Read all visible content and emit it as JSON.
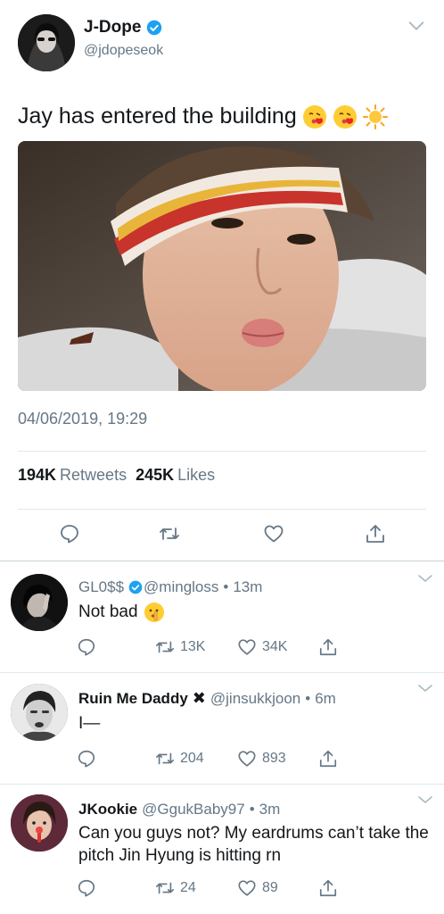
{
  "main": {
    "author_name": "J-Dope",
    "author_handle": "@jdopeseok",
    "text": "Jay has entered the building",
    "timestamp": "04/06/2019, 19:29",
    "retweets_count": "194K",
    "retweets_label": "Retweets",
    "likes_count": "245K",
    "likes_label": "Likes"
  },
  "replies": [
    {
      "name": "GL0$$",
      "handle": "@mingloss",
      "time": "13m",
      "text": "Not bad",
      "retweets": "13K",
      "likes": "34K"
    },
    {
      "name": "Ruin Me Daddy",
      "handle": "@jinsukkjoon",
      "time": "6m",
      "text": "I—",
      "retweets": "204",
      "likes": "893"
    },
    {
      "name": "JKookie",
      "handle": "@GgukBaby97",
      "time": "3m",
      "text": "Can you guys not? My eardrums can’t take the pitch Jin Hyung is hitting rn",
      "retweets": "24",
      "likes": "89"
    }
  ],
  "separator": "•",
  "cross_mark": "✖",
  "colors": {
    "text": "#14171a",
    "secondary": "#657786",
    "verified": "#1da1f2",
    "divider": "#e1e8ed"
  },
  "icons": [
    "verified-icon",
    "chevron-down-icon",
    "reply-icon",
    "retweet-icon",
    "like-icon",
    "share-icon"
  ]
}
